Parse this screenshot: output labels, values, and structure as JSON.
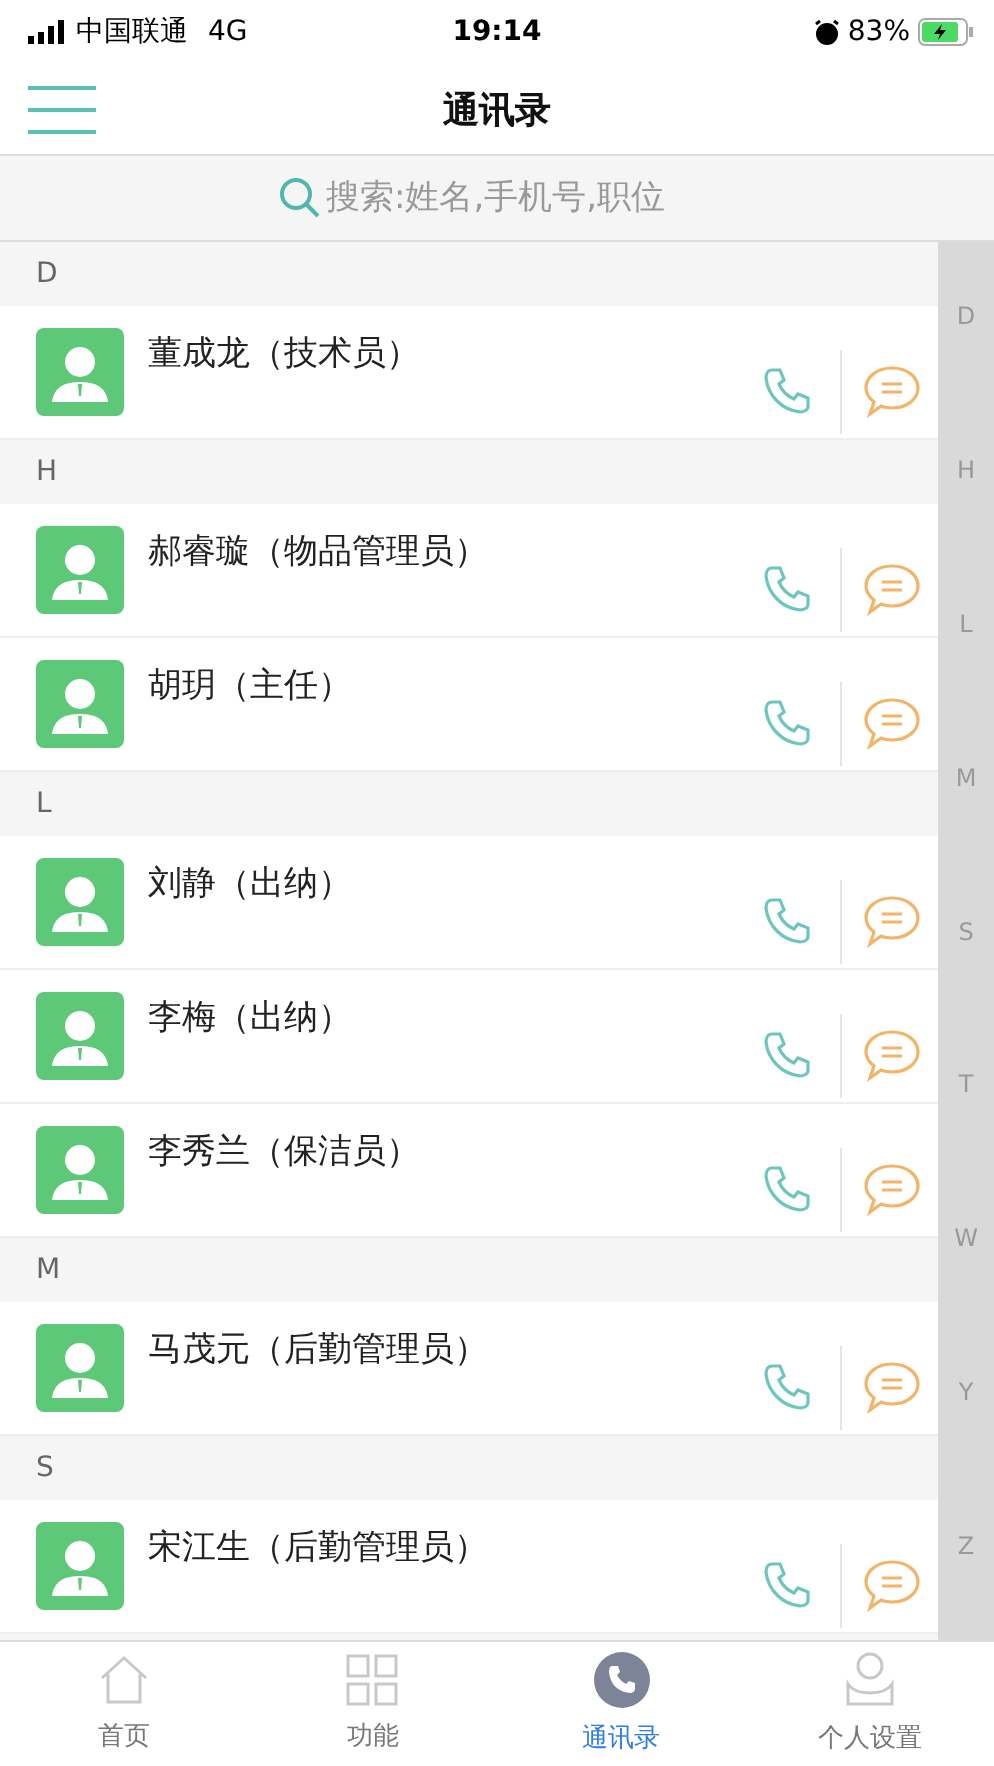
{
  "status_bar": {
    "carrier": "中国联通",
    "network": "4G",
    "time": "19:14",
    "battery": "83%"
  },
  "header": {
    "title": "通讯录"
  },
  "search": {
    "placeholder": "搜索:姓名,手机号,职位"
  },
  "sections": [
    {
      "letter": "D",
      "contacts": [
        {
          "name": "董成龙（技术员）"
        }
      ]
    },
    {
      "letter": "H",
      "contacts": [
        {
          "name": "郝睿璇（物品管理员）"
        },
        {
          "name": "胡玥（主任）"
        }
      ]
    },
    {
      "letter": "L",
      "contacts": [
        {
          "name": "刘静（出纳）"
        },
        {
          "name": "李梅（出纳）"
        },
        {
          "name": "李秀兰（保洁员）"
        }
      ]
    },
    {
      "letter": "M",
      "contacts": [
        {
          "name": "马茂元（后勤管理员）"
        }
      ]
    },
    {
      "letter": "S",
      "contacts": [
        {
          "name": "宋江生（后勤管理员）"
        }
      ]
    }
  ],
  "index": [
    "D",
    "H",
    "L",
    "M",
    "S",
    "T",
    "W",
    "Y",
    "Z"
  ],
  "tabs": [
    {
      "kind": "home",
      "label": "首页",
      "selected": false
    },
    {
      "kind": "grid",
      "label": "功能",
      "selected": false
    },
    {
      "kind": "phone",
      "label": "通讯录",
      "selected": true
    },
    {
      "kind": "person",
      "label": "个人设置",
      "selected": false
    }
  ]
}
